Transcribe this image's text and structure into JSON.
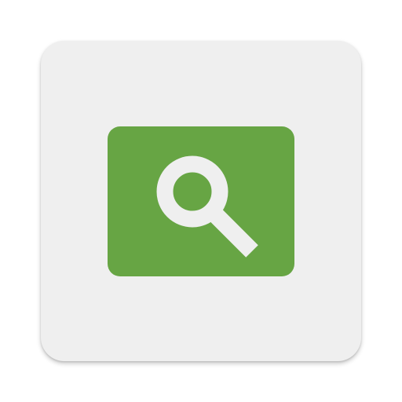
{
  "icon": {
    "name": "search-icon",
    "tile_color": "#efefef",
    "badge_color": "#67a544",
    "glyph_color": "#efefef"
  }
}
